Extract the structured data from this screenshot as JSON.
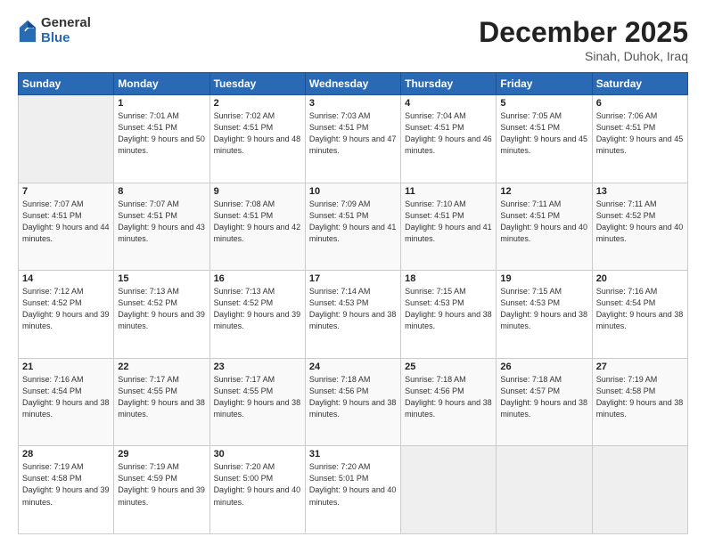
{
  "logo": {
    "general": "General",
    "blue": "Blue"
  },
  "header": {
    "month": "December 2025",
    "location": "Sinah, Duhok, Iraq"
  },
  "weekdays": [
    "Sunday",
    "Monday",
    "Tuesday",
    "Wednesday",
    "Thursday",
    "Friday",
    "Saturday"
  ],
  "weeks": [
    [
      {
        "day": "",
        "sunrise": "",
        "sunset": "",
        "daylight": "",
        "empty": true
      },
      {
        "day": "1",
        "sunrise": "7:01 AM",
        "sunset": "4:51 PM",
        "daylight": "9 hours and 50 minutes."
      },
      {
        "day": "2",
        "sunrise": "7:02 AM",
        "sunset": "4:51 PM",
        "daylight": "9 hours and 48 minutes."
      },
      {
        "day": "3",
        "sunrise": "7:03 AM",
        "sunset": "4:51 PM",
        "daylight": "9 hours and 47 minutes."
      },
      {
        "day": "4",
        "sunrise": "7:04 AM",
        "sunset": "4:51 PM",
        "daylight": "9 hours and 46 minutes."
      },
      {
        "day": "5",
        "sunrise": "7:05 AM",
        "sunset": "4:51 PM",
        "daylight": "9 hours and 45 minutes."
      },
      {
        "day": "6",
        "sunrise": "7:06 AM",
        "sunset": "4:51 PM",
        "daylight": "9 hours and 45 minutes."
      }
    ],
    [
      {
        "day": "7",
        "sunrise": "7:07 AM",
        "sunset": "4:51 PM",
        "daylight": "9 hours and 44 minutes."
      },
      {
        "day": "8",
        "sunrise": "7:07 AM",
        "sunset": "4:51 PM",
        "daylight": "9 hours and 43 minutes."
      },
      {
        "day": "9",
        "sunrise": "7:08 AM",
        "sunset": "4:51 PM",
        "daylight": "9 hours and 42 minutes."
      },
      {
        "day": "10",
        "sunrise": "7:09 AM",
        "sunset": "4:51 PM",
        "daylight": "9 hours and 41 minutes."
      },
      {
        "day": "11",
        "sunrise": "7:10 AM",
        "sunset": "4:51 PM",
        "daylight": "9 hours and 41 minutes."
      },
      {
        "day": "12",
        "sunrise": "7:11 AM",
        "sunset": "4:51 PM",
        "daylight": "9 hours and 40 minutes."
      },
      {
        "day": "13",
        "sunrise": "7:11 AM",
        "sunset": "4:52 PM",
        "daylight": "9 hours and 40 minutes."
      }
    ],
    [
      {
        "day": "14",
        "sunrise": "7:12 AM",
        "sunset": "4:52 PM",
        "daylight": "9 hours and 39 minutes."
      },
      {
        "day": "15",
        "sunrise": "7:13 AM",
        "sunset": "4:52 PM",
        "daylight": "9 hours and 39 minutes."
      },
      {
        "day": "16",
        "sunrise": "7:13 AM",
        "sunset": "4:52 PM",
        "daylight": "9 hours and 39 minutes."
      },
      {
        "day": "17",
        "sunrise": "7:14 AM",
        "sunset": "4:53 PM",
        "daylight": "9 hours and 38 minutes."
      },
      {
        "day": "18",
        "sunrise": "7:15 AM",
        "sunset": "4:53 PM",
        "daylight": "9 hours and 38 minutes."
      },
      {
        "day": "19",
        "sunrise": "7:15 AM",
        "sunset": "4:53 PM",
        "daylight": "9 hours and 38 minutes."
      },
      {
        "day": "20",
        "sunrise": "7:16 AM",
        "sunset": "4:54 PM",
        "daylight": "9 hours and 38 minutes."
      }
    ],
    [
      {
        "day": "21",
        "sunrise": "7:16 AM",
        "sunset": "4:54 PM",
        "daylight": "9 hours and 38 minutes."
      },
      {
        "day": "22",
        "sunrise": "7:17 AM",
        "sunset": "4:55 PM",
        "daylight": "9 hours and 38 minutes."
      },
      {
        "day": "23",
        "sunrise": "7:17 AM",
        "sunset": "4:55 PM",
        "daylight": "9 hours and 38 minutes."
      },
      {
        "day": "24",
        "sunrise": "7:18 AM",
        "sunset": "4:56 PM",
        "daylight": "9 hours and 38 minutes."
      },
      {
        "day": "25",
        "sunrise": "7:18 AM",
        "sunset": "4:56 PM",
        "daylight": "9 hours and 38 minutes."
      },
      {
        "day": "26",
        "sunrise": "7:18 AM",
        "sunset": "4:57 PM",
        "daylight": "9 hours and 38 minutes."
      },
      {
        "day": "27",
        "sunrise": "7:19 AM",
        "sunset": "4:58 PM",
        "daylight": "9 hours and 38 minutes."
      }
    ],
    [
      {
        "day": "28",
        "sunrise": "7:19 AM",
        "sunset": "4:58 PM",
        "daylight": "9 hours and 39 minutes."
      },
      {
        "day": "29",
        "sunrise": "7:19 AM",
        "sunset": "4:59 PM",
        "daylight": "9 hours and 39 minutes."
      },
      {
        "day": "30",
        "sunrise": "7:20 AM",
        "sunset": "5:00 PM",
        "daylight": "9 hours and 40 minutes."
      },
      {
        "day": "31",
        "sunrise": "7:20 AM",
        "sunset": "5:01 PM",
        "daylight": "9 hours and 40 minutes."
      },
      {
        "day": "",
        "sunrise": "",
        "sunset": "",
        "daylight": "",
        "empty": true
      },
      {
        "day": "",
        "sunrise": "",
        "sunset": "",
        "daylight": "",
        "empty": true
      },
      {
        "day": "",
        "sunrise": "",
        "sunset": "",
        "daylight": "",
        "empty": true
      }
    ]
  ]
}
